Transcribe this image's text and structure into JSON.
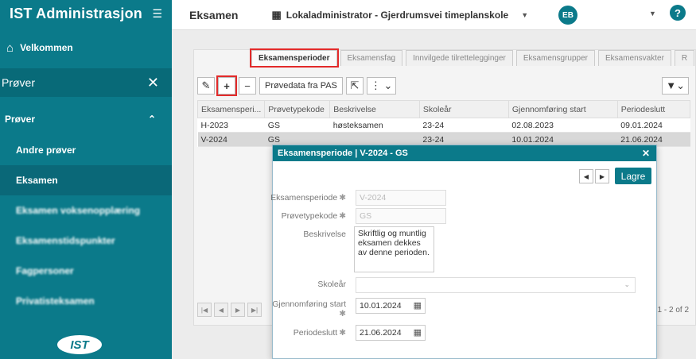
{
  "sidebar": {
    "app_title": "IST Administrasjon",
    "home_label": "Velkommen",
    "section_label": "Prøver",
    "group_label": "Prøver",
    "items": [
      {
        "label": "Andre prøver"
      },
      {
        "label": "Eksamen"
      },
      {
        "label": "Eksamen voksenopplæring"
      },
      {
        "label": "Eksamenstidspunkter"
      },
      {
        "label": "Fagpersoner"
      },
      {
        "label": "Privatisteksamen"
      }
    ],
    "logo_text": "IST"
  },
  "topbar": {
    "title": "Eksamen",
    "org": "Lokaladministrator - Gjerdrumsvei timeplanskole",
    "avatar": "EB",
    "help": "?"
  },
  "tabs": [
    "Eksamensperioder",
    "Eksamensfag",
    "Innvilgede tilrettelegginger",
    "Eksamensgrupper",
    "Eksamensvakter",
    "R"
  ],
  "toolbar": {
    "provedata_label": "Prøvedata fra PAS"
  },
  "grid": {
    "columns": [
      "Eksamensperi...",
      "Prøvetypekode",
      "Beskrivelse",
      "Skoleår",
      "Gjennomføring start",
      "Periodeslutt"
    ],
    "rows": [
      [
        "H-2023",
        "GS",
        "høsteksamen",
        "23-24",
        "02.08.2023",
        "09.01.2024"
      ],
      [
        "V-2024",
        "GS",
        "",
        "23-24",
        "10.01.2024",
        "21.06.2024"
      ]
    ],
    "pager_info": "1 - 2 of 2"
  },
  "dialog": {
    "title": "Eksamensperiode | V-2024 - GS",
    "save_label": "Lagre",
    "fields": {
      "periode_label": "Eksamensperiode",
      "periode_value": "V-2024",
      "provetype_label": "Prøvetypekode",
      "provetype_value": "GS",
      "beskrivelse_label": "Beskrivelse",
      "beskrivelse_value": "Skriftlig og muntlig eksamen dekkes av denne perioden.",
      "skolear_label": "Skoleår",
      "gjennomforing_label": "Gjennomføring start",
      "gjennomforing_value": "10.01.2024",
      "periodeslutt_label": "Periodeslutt",
      "periodeslutt_value": "21.06.2024"
    }
  },
  "colors": {
    "brand": "#0b7a8a",
    "highlight": "#e32a2a"
  }
}
